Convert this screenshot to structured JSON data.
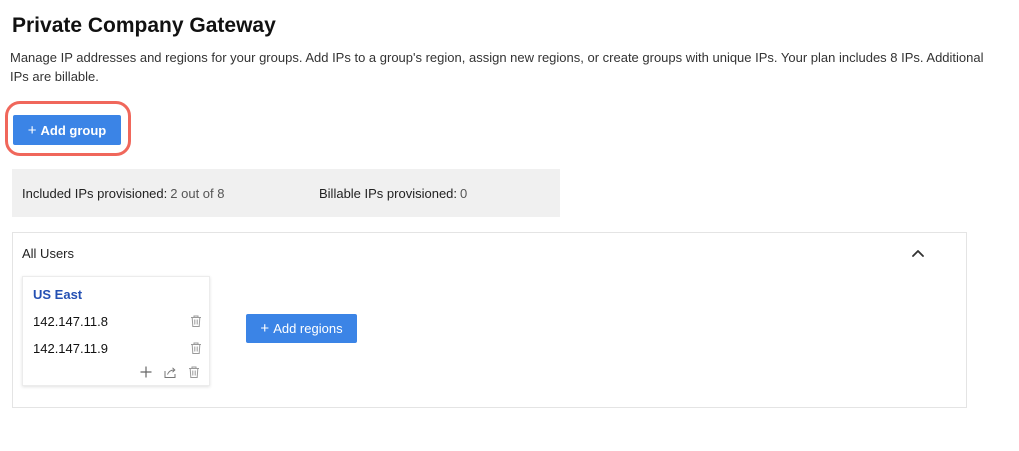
{
  "page": {
    "title": "Private Company Gateway",
    "description": "Manage IP addresses and regions for your groups. Add IPs to a group's region, assign new regions, or create groups with unique IPs. Your plan includes 8 IPs. Additional IPs are billable."
  },
  "actions": {
    "add_group_label": "Add group",
    "add_group_plus": "+"
  },
  "summary": {
    "included_label": "Included IPs provisioned:",
    "included_value": "2 out of 8",
    "billable_label": "Billable IPs provisioned:",
    "billable_value": "0"
  },
  "groups": [
    {
      "name": "All Users",
      "regions": [
        {
          "name": "US East",
          "ips": [
            "142.147.11.8",
            "142.147.11.9"
          ]
        }
      ],
      "add_regions_label": "Add regions",
      "add_regions_plus": "+"
    }
  ],
  "colors": {
    "primary": "#3b84e6",
    "highlight": "#f0675b",
    "region_name": "#2450b3",
    "summary_bg": "#f0f0f0"
  },
  "icons": {
    "collapse": "chevron-up-icon",
    "delete": "trash-icon",
    "add_ip": "plus-icon",
    "share": "share-icon"
  }
}
